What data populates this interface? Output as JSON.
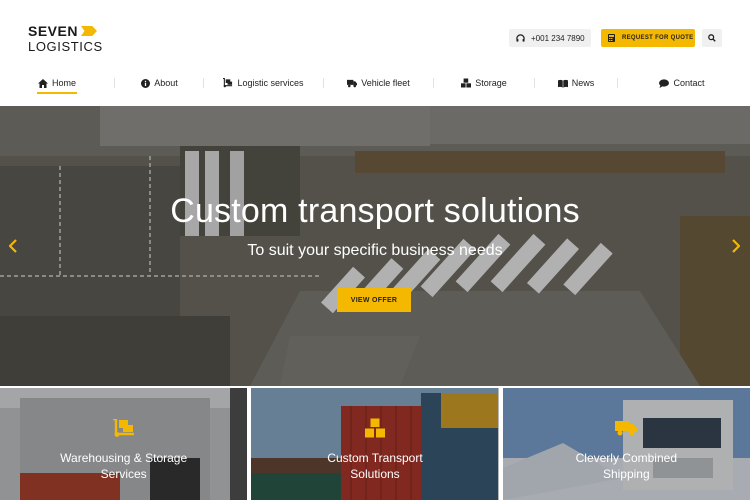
{
  "brand": {
    "line1": "SEVEN",
    "line2": "LOGISTICS"
  },
  "header": {
    "phone": "+001 234 7890",
    "quote_label": "REQUEST FOR QUOTE"
  },
  "nav": [
    {
      "label": "Home",
      "icon": "home-icon"
    },
    {
      "label": "About",
      "icon": "info-icon"
    },
    {
      "label": "Logistic services",
      "icon": "dolly-icon"
    },
    {
      "label": "Vehicle fleet",
      "icon": "truck-icon"
    },
    {
      "label": "Storage",
      "icon": "boxes-icon"
    },
    {
      "label": "News",
      "icon": "book-icon"
    },
    {
      "label": "Contact",
      "icon": "chat-icon"
    }
  ],
  "hero": {
    "title": "Custom transport solutions",
    "subtitle": "To suit your specific business needs",
    "button": "VIEW OFFER"
  },
  "cards": [
    {
      "line1": "Warehousing & Storage",
      "line2": "Services",
      "icon": "dolly-icon"
    },
    {
      "line1": "Custom Transport",
      "line2": "Solutions",
      "icon": "boxes-icon"
    },
    {
      "line1": "Cleverly Combined",
      "line2": "Shipping",
      "icon": "truck-icon"
    }
  ],
  "colors": {
    "accent": "#f5b800"
  }
}
